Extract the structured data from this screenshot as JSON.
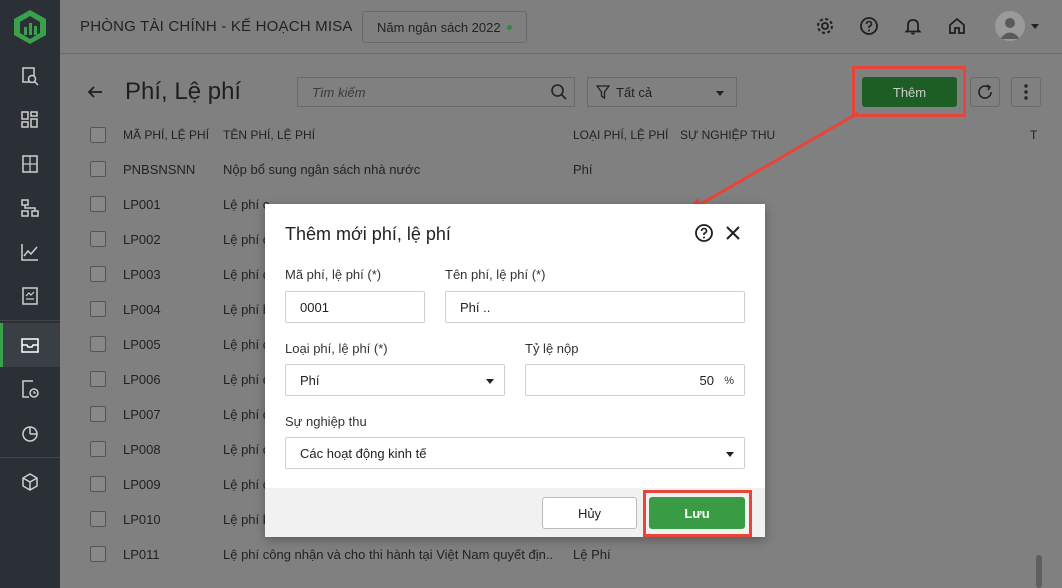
{
  "header": {
    "app_title": "PHÒNG TÀI CHÍNH - KẾ HOẠCH MISA",
    "budget_year": "Năm ngân sách 2022"
  },
  "sidebar": {
    "items": [
      {
        "icon": "search-document-icon"
      },
      {
        "icon": "dashboard-icon"
      },
      {
        "icon": "calculator-icon"
      },
      {
        "icon": "org-chart-icon"
      },
      {
        "icon": "line-chart-icon"
      },
      {
        "icon": "report-icon"
      },
      {
        "icon": "inbox-icon",
        "active": true
      },
      {
        "icon": "document-clock-icon"
      },
      {
        "icon": "pie-chart-icon"
      },
      {
        "icon": "cube-icon"
      }
    ]
  },
  "toolbar": {
    "page_title": "Phí, Lệ phí",
    "search_placeholder": "Tìm kiếm",
    "filter_value": "Tất cả",
    "add_label": "Thêm"
  },
  "table": {
    "headers": {
      "code": "MÃ PHÍ, LỆ PHÍ",
      "name": "TÊN PHÍ, LỆ PHÍ",
      "type": "LOẠI PHÍ, LỆ PHÍ",
      "career": "SỰ NGHIỆP THU",
      "last": "T"
    },
    "rows": [
      {
        "code": "PNBSNSNN",
        "name": "Nộp bổ sung ngân sách nhà nước",
        "type": "Phí"
      },
      {
        "code": "LP001",
        "name": "Lệ phí c",
        "type": ""
      },
      {
        "code": "LP002",
        "name": "Lệ phí c",
        "type": ""
      },
      {
        "code": "LP003",
        "name": "Lệ phí c",
        "type": ""
      },
      {
        "code": "LP004",
        "name": "Lệ phí h",
        "type": ""
      },
      {
        "code": "LP005",
        "name": "Lệ phí c",
        "type": ""
      },
      {
        "code": "LP006",
        "name": "Lệ phí c",
        "type": ""
      },
      {
        "code": "LP007",
        "name": "Lệ phí c",
        "type": ""
      },
      {
        "code": "LP008",
        "name": "Lệ phí c",
        "type": ""
      },
      {
        "code": "LP009",
        "name": "Lệ phí c",
        "type": ""
      },
      {
        "code": "LP010",
        "name": "Lệ phí k",
        "type": ""
      },
      {
        "code": "LP011",
        "name": "Lệ phí công nhận và cho thi hành tại Việt Nam quyết địn...",
        "type": "Lệ Phí"
      }
    ]
  },
  "dialog": {
    "title": "Thêm mới phí, lệ phí",
    "code_label": "Mã phí, lệ phí (*)",
    "code_value": "0001",
    "name_label": "Tên phí, lệ phí (*)",
    "name_value": "Phí ..",
    "type_label": "Loại phí, lệ phí (*)",
    "type_value": "Phí",
    "rate_label": "Tỷ lệ nộp",
    "rate_value": "50",
    "rate_unit": "%",
    "career_label": "Sự nghiệp thu",
    "career_value": "Các hoạt động kinh tế",
    "cancel_label": "Hủy",
    "save_label": "Lưu"
  },
  "colors": {
    "sidebar_bg": "#2b2f36",
    "accent_green": "#3a9b45",
    "highlight_red": "#e8443a"
  }
}
